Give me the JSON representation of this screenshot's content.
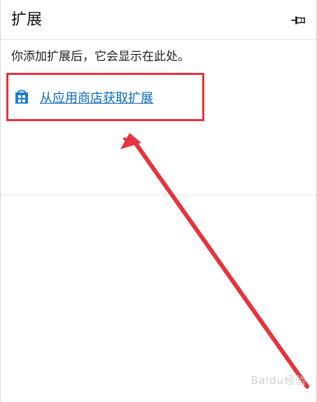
{
  "header": {
    "title": "扩展",
    "pin_icon": "pin-icon"
  },
  "content": {
    "empty_message": "你添加扩展后，它会显示在此处。",
    "store_link": {
      "icon": "store-bag-icon",
      "label": "从应用商店获取扩展"
    }
  },
  "annotation": {
    "highlight_color": "#e8323c",
    "arrow_color": "#e8323c"
  },
  "watermark": {
    "text": "Baidu经验"
  },
  "colors": {
    "link": "#0a6ac4",
    "store_icon": "#1c7fd1"
  }
}
